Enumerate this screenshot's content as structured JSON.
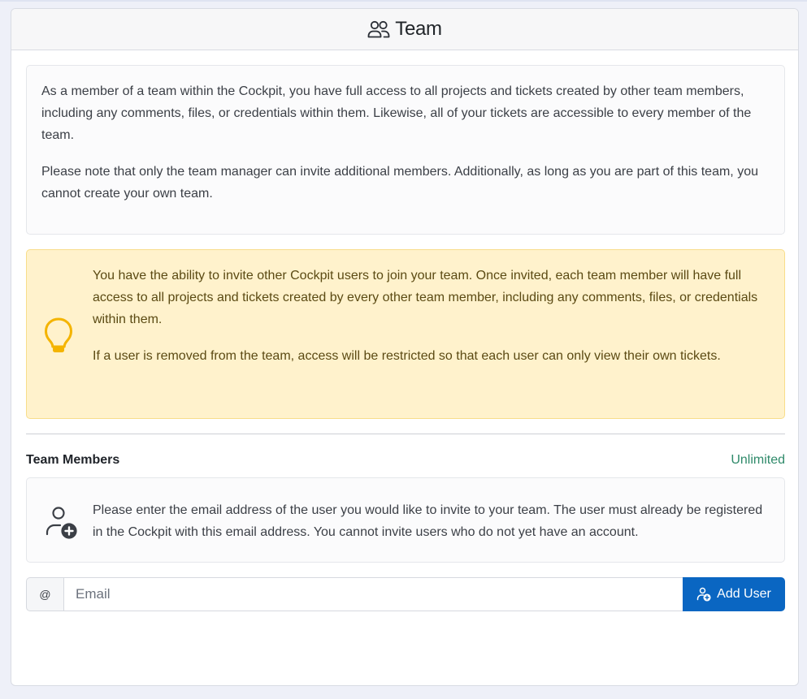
{
  "header": {
    "title": "Team",
    "icon": "people-icon"
  },
  "info": {
    "paragraph1": "As a member of a team within the Cockpit, you have full access to all projects and tickets created by other team members, including any comments, files, or credentials within them. Likewise, all of your tickets are accessible to every member of the team.",
    "paragraph2": "Please note that only the team manager can invite additional members. Additionally, as long as you are part of this team, you cannot create your own team."
  },
  "tip": {
    "icon": "lightbulb-icon",
    "paragraph1": "You have the ability to invite other Cockpit users to join your team. Once invited, each team member will have full access to all projects and tickets created by every other team member, including any comments, files, or credentials within them.",
    "paragraph2": "If a user is removed from the team, access will be restricted so that each user can only view their own tickets."
  },
  "members": {
    "title": "Team Members",
    "limit": "Unlimited"
  },
  "invite": {
    "icon": "add-user-icon",
    "text": "Please enter the email address of the user you would like to invite to your team. The user must already be registered in the Cockpit with this email address. You cannot invite users who do not yet have an account."
  },
  "form": {
    "addon": "@",
    "email_placeholder": "Email",
    "email_value": "",
    "button_label": "Add User"
  },
  "colors": {
    "primary": "#0a66c2",
    "tip_background": "#fff2cc",
    "tip_icon": "#f4b400",
    "limit_text": "#2f8a6a"
  }
}
